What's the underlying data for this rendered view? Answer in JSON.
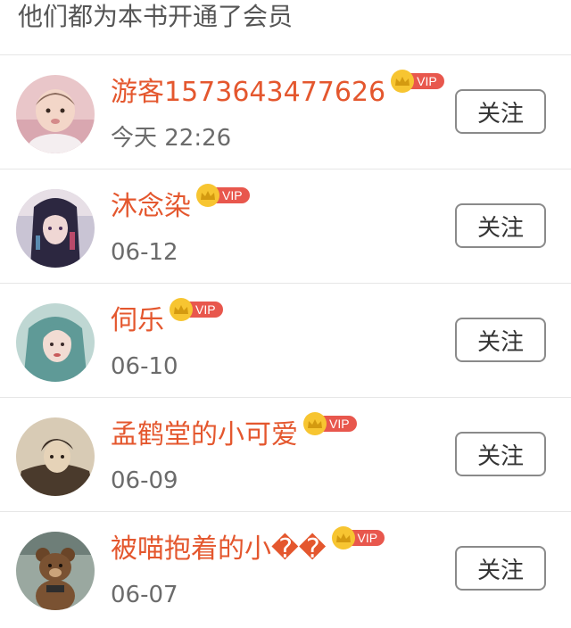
{
  "header": {
    "title": "他们都为本书开通了会员"
  },
  "vip_label": "VIP",
  "follow_label": "关注",
  "members": [
    {
      "name": "游客1573643477626",
      "time": "今天 22:26",
      "avatar_icon": "baby-photo-avatar-icon"
    },
    {
      "name": "沐念染",
      "time": "06-12",
      "avatar_icon": "anime-girl-avatar-icon"
    },
    {
      "name": "伺乐",
      "time": "06-10",
      "avatar_icon": "girl-portrait-avatar-icon"
    },
    {
      "name": "孟鹤堂的小可爱",
      "time": "06-09",
      "avatar_icon": "sepia-portrait-avatar-icon"
    },
    {
      "name": "被喵抱着的小��",
      "time": "06-07",
      "avatar_icon": "bear-doll-avatar-icon"
    }
  ],
  "colors": {
    "name": "#e4572e",
    "vip_tag": "#e8574d",
    "crown": "#f7c531",
    "date": "#6b6b6b"
  }
}
